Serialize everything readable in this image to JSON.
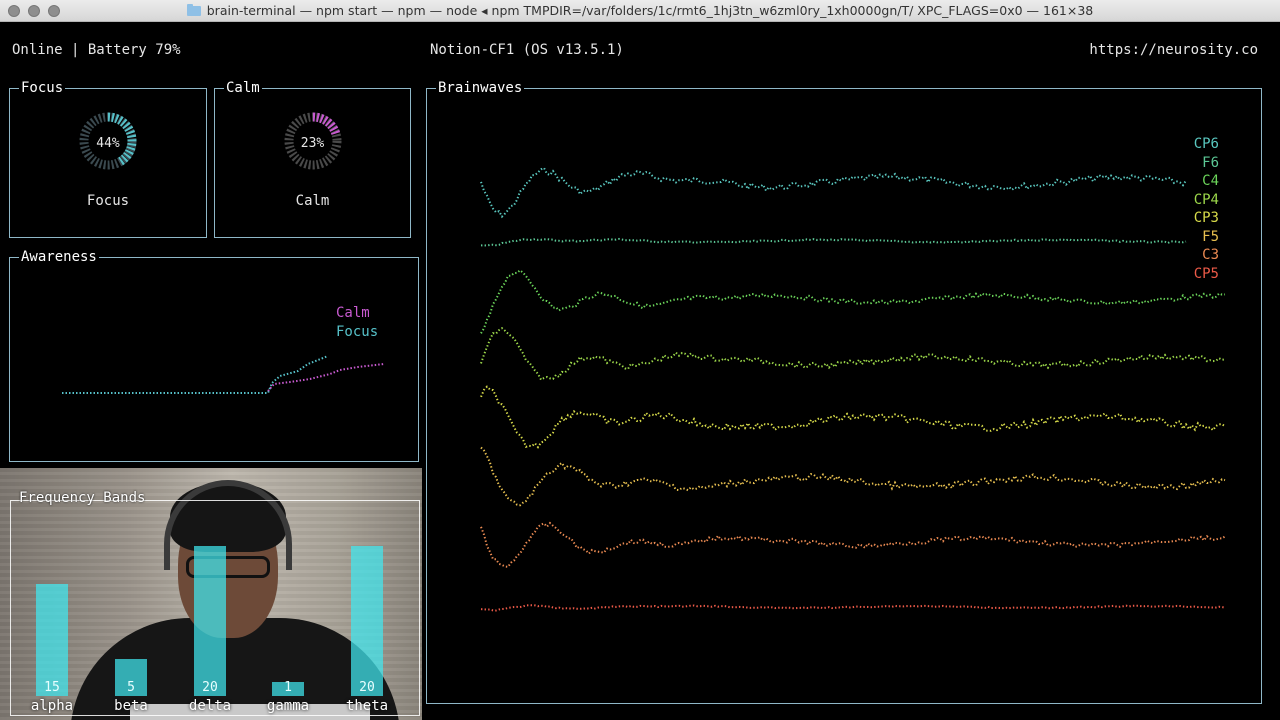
{
  "window": {
    "title": "brain-terminal — npm start — npm — node ◂ npm TMPDIR=/var/folders/1c/rmt6_1hj3tn_w6zml0ry_1xh0000gn/T/ XPC_FLAGS=0x0 — 161×38"
  },
  "header": {
    "status": "Online | Battery 79%",
    "device": "Notion-CF1 (OS v13.5.1)",
    "url": "https://neurosity.co"
  },
  "focus": {
    "title": "Focus",
    "percent_text": "44%",
    "value": 0.44,
    "label": "Focus",
    "color": "#56c1c9"
  },
  "calm": {
    "title": "Calm",
    "percent_text": "23%",
    "value": 0.23,
    "label": "Calm",
    "color": "#c85ad0"
  },
  "awareness": {
    "title": "Awareness",
    "legend": [
      {
        "label": "Calm",
        "color": "#c85ad0"
      },
      {
        "label": "Focus",
        "color": "#56c1c9"
      }
    ]
  },
  "frequency_bands": {
    "title": "Frequency Bands",
    "bands": [
      {
        "name": "alpha",
        "value": 15
      },
      {
        "name": "beta",
        "value": 5
      },
      {
        "name": "delta",
        "value": 20
      },
      {
        "name": "gamma",
        "value": 1
      },
      {
        "name": "theta",
        "value": 20
      }
    ]
  },
  "brainwaves": {
    "title": "Brainwaves",
    "channels": [
      {
        "name": "CP6",
        "color": "#5ac8c0"
      },
      {
        "name": "F6",
        "color": "#5cc896"
      },
      {
        "name": "C4",
        "color": "#6bd45a"
      },
      {
        "name": "CP4",
        "color": "#9cd84a"
      },
      {
        "name": "CP3",
        "color": "#d8dc4a"
      },
      {
        "name": "F5",
        "color": "#e8c050"
      },
      {
        "name": "C3",
        "color": "#ea8a52"
      },
      {
        "name": "CP5",
        "color": "#ec5a48"
      }
    ]
  }
}
